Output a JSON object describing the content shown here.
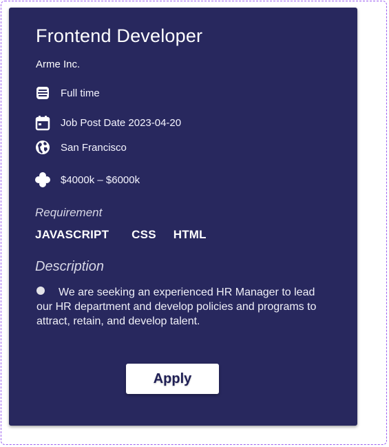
{
  "job": {
    "title": "Frontend Developer",
    "company": "Arme Inc.",
    "employment_type": "Full time",
    "post_date": "Job Post Date 2023-04-20",
    "location": "San Francisco",
    "salary": "$4000k – $6000k"
  },
  "requirements": {
    "label": "Requirement",
    "skills": [
      "JAVASCRIPT",
      "CSS",
      "HTML"
    ]
  },
  "description": {
    "label": "Description",
    "text": "We are seeking an experienced HR Manager to lead our HR department and develop policies and programs to attract, retain, and develop talent."
  },
  "actions": {
    "apply_label": "Apply"
  },
  "colors": {
    "card_background": "#28285e",
    "frame_border": "#9b5cf0",
    "button_background": "#ffffff",
    "button_text": "#1f1f55"
  },
  "icons": {
    "employment_type": "stack-icon",
    "post_date": "calendar-icon",
    "location": "globe-icon",
    "salary": "flower-icon",
    "description_bullet": "bullet-icon"
  }
}
